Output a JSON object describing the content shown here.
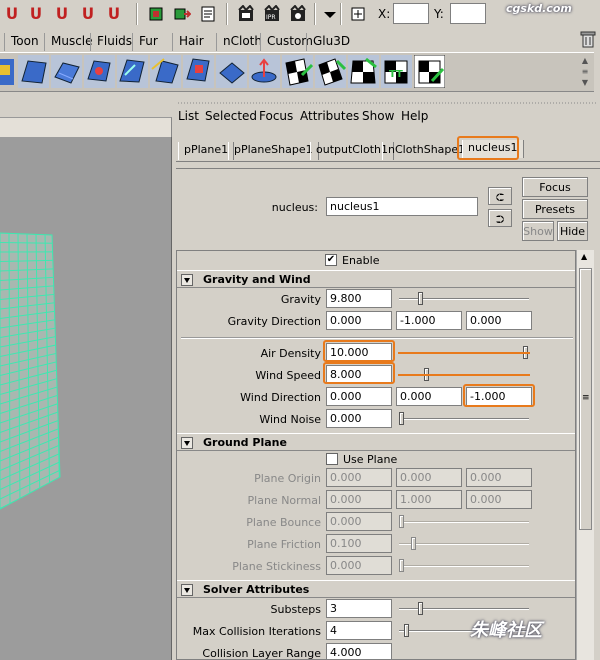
{
  "toolbar": {
    "coord_x_label": "X:",
    "coord_y_label": "Y:",
    "icons": [
      "snap-to-grids-icon",
      "snap-to-curves-icon",
      "snap-to-points-icon",
      "snap-to-view-planes-icon",
      "make-live-icon",
      "input-lines-icon",
      "output-lines-icon",
      "construction-history-icon",
      "render-current-frame-icon",
      "ipr-render-icon",
      "render-settings-icon",
      "selection-input-icon"
    ]
  },
  "watermark_top": "cgskd.com",
  "shelf_tabs": [
    "Toon",
    "Muscle",
    "Fluids",
    "Fur",
    "Hair",
    "nCloth",
    "Custom",
    "Glu3D"
  ],
  "attribute_editor": {
    "menu": [
      "List",
      "Selected",
      "Focus",
      "Attributes",
      "Show",
      "Help"
    ],
    "tabs": [
      "pPlane1",
      "pPlaneShape1",
      "outputCloth1",
      "nClothShape1",
      "nucleus1"
    ],
    "active_tab": "nucleus1",
    "node_label": "nucleus:",
    "node_value": "nucleus1",
    "buttons": {
      "focus": "Focus",
      "presets": "Presets",
      "show": "Show",
      "hide": "Hide"
    },
    "enable_label": "Enable",
    "enable_checked": "✔",
    "sections": {
      "gravity_wind": {
        "title": "Gravity and Wind",
        "gravity_label": "Gravity",
        "gravity": "9.800",
        "gravity_dir_label": "Gravity Direction",
        "gravity_dir": [
          "0.000",
          "-1.000",
          "0.000"
        ],
        "air_density_label": "Air Density",
        "air_density": "10.000",
        "wind_speed_label": "Wind Speed",
        "wind_speed": "8.000",
        "wind_dir_label": "Wind Direction",
        "wind_dir": [
          "0.000",
          "0.000",
          "-1.000"
        ],
        "wind_noise_label": "Wind Noise",
        "wind_noise": "0.000",
        "gravity_slider": 0.15,
        "air_density_slider": 1.0,
        "wind_speed_slider": 0.2,
        "wind_noise_slider": 0.0
      },
      "ground_plane": {
        "title": "Ground Plane",
        "use_plane_label": "Use Plane",
        "plane_origin_label": "Plane Origin",
        "plane_origin": [
          "0.000",
          "0.000",
          "0.000"
        ],
        "plane_normal_label": "Plane Normal",
        "plane_normal": [
          "0.000",
          "1.000",
          "0.000"
        ],
        "plane_bounce_label": "Plane Bounce",
        "plane_bounce": "0.000",
        "plane_friction_label": "Plane Friction",
        "plane_friction": "0.100",
        "plane_stickiness_label": "Plane Stickiness",
        "plane_stickiness": "0.000",
        "plane_friction_slider": 0.1
      },
      "solver": {
        "title": "Solver Attributes",
        "substeps_label": "Substeps",
        "substeps": "3",
        "max_collision_label": "Max Collision Iterations",
        "max_collision": "4",
        "collision_layer_label": "Collision Layer Range",
        "collision_layer": "4.000",
        "substeps_slider": 0.15,
        "max_collision_slider": 0.04
      }
    }
  },
  "watermark_bottom": "朱峰社区",
  "colors": {
    "highlight": "#e87a1c",
    "mesh": "#3ee8b0",
    "viewport": "#9c9c9c"
  }
}
